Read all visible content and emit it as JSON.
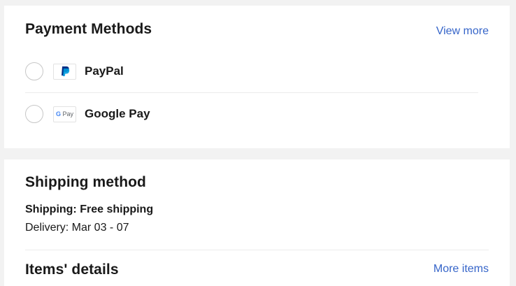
{
  "payment": {
    "title": "Payment Methods",
    "view_more": "View more",
    "methods": [
      {
        "label": "PayPal",
        "icon": "paypal-logo-icon",
        "selected": false
      },
      {
        "label": "Google Pay",
        "icon": "google-pay-logo-icon",
        "logo_text_g": "G",
        "logo_text_pay": "Pay",
        "selected": false
      }
    ]
  },
  "shipping": {
    "title": "Shipping method",
    "shipping_line": "Shipping: Free shipping",
    "delivery_line": "Delivery: Mar 03 - 07"
  },
  "items": {
    "title": "Items' details",
    "more_items": "More items"
  },
  "colors": {
    "link": "#3665c9",
    "paypal_dark": "#003087",
    "paypal_light": "#009cde",
    "background": "#f2f2f2"
  }
}
